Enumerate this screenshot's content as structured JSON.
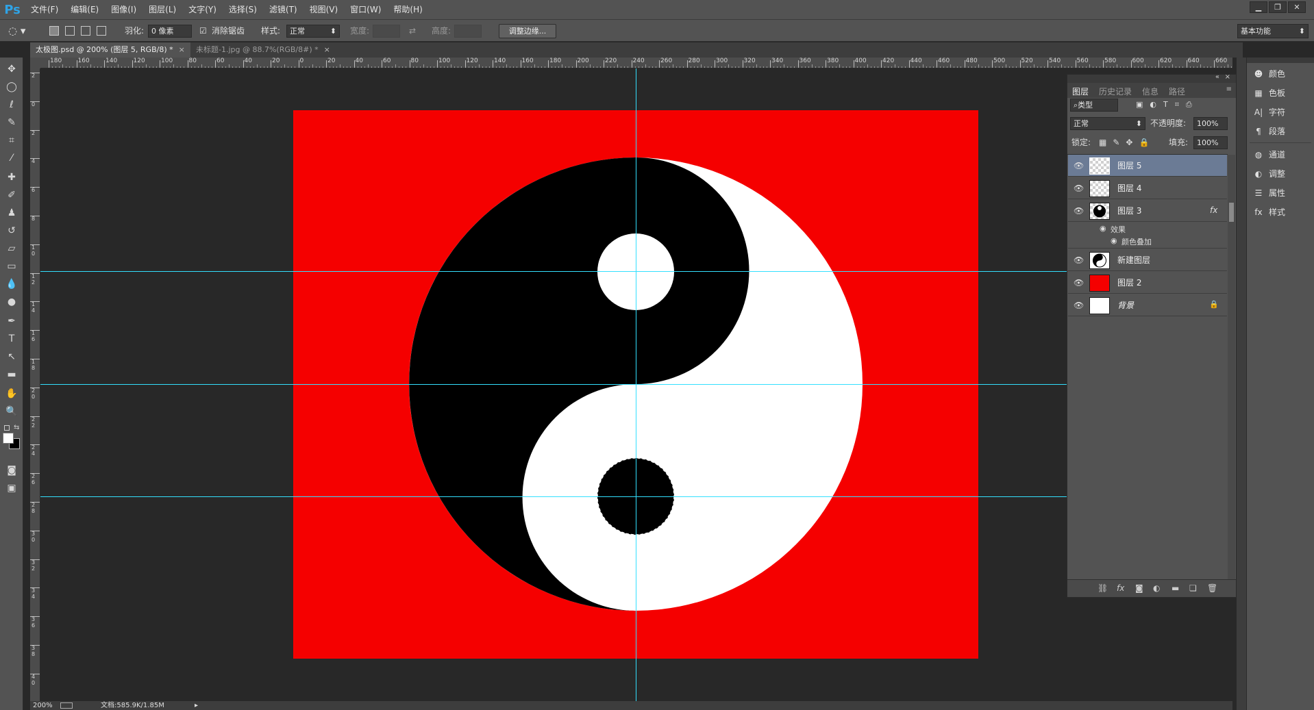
{
  "app": {
    "logo": "Ps"
  },
  "menu": [
    "文件(F)",
    "编辑(E)",
    "图像(I)",
    "图层(L)",
    "文字(Y)",
    "选择(S)",
    "滤镜(T)",
    "视图(V)",
    "窗口(W)",
    "帮助(H)"
  ],
  "options": {
    "feather_label": "羽化:",
    "feather_value": "0 像素",
    "antialias_label": "消除锯齿",
    "style_label": "样式:",
    "style_value": "正常",
    "width_label": "宽度:",
    "height_label": "高度:",
    "refine_edge": "调整边缘...",
    "workspace": "基本功能"
  },
  "tabs": [
    {
      "label": "太极图.psd @ 200% (图层 5, RGB/8) *"
    },
    {
      "label": "未标题-1.jpg @ 88.7%(RGB/8#) *"
    }
  ],
  "ruler": {
    "h_ticks": [
      "180",
      "160",
      "140",
      "120",
      "100",
      "80",
      "60",
      "40",
      "20",
      "0",
      "20",
      "40",
      "60",
      "80",
      "100",
      "120",
      "140",
      "160",
      "180",
      "200",
      "220",
      "240",
      "260",
      "280",
      "300",
      "320",
      "340",
      "360",
      "380",
      "400",
      "420",
      "440",
      "460",
      "480",
      "500",
      "520",
      "540",
      "560",
      "580",
      "600",
      "620",
      "640",
      "660"
    ],
    "v_ticks": [
      "2",
      "0",
      "2",
      "4",
      "6",
      "8",
      "1 0",
      "1 2",
      "1 4",
      "1 6",
      "1 8",
      "2 0",
      "2 2",
      "2 4",
      "2 6",
      "2 8",
      "3 0",
      "3 2",
      "3 4",
      "3 6",
      "3 8",
      "4 0"
    ]
  },
  "status": {
    "zoom": "200%",
    "doc": "文档:585.9K/1.85M"
  },
  "layers_panel": {
    "tabs": [
      "图层",
      "历史记录",
      "信息",
      "路径"
    ],
    "filter": "类型",
    "blend_mode": "正常",
    "opacity_label": "不透明度:",
    "opacity": "100%",
    "lock_label": "锁定:",
    "fill_label": "填充:",
    "fill": "100%",
    "layers": [
      {
        "name": "图层 5",
        "selected": true
      },
      {
        "name": "图层 4"
      },
      {
        "name": "图层 3",
        "fx": "fx",
        "effects_label": "效果",
        "effect": "颜色叠加"
      },
      {
        "name": "新建图层"
      },
      {
        "name": "图层 2"
      },
      {
        "name": "背景"
      }
    ]
  },
  "dock": [
    "颜色",
    "色板",
    "字符",
    "段落",
    "通道",
    "调整",
    "属性",
    "样式"
  ],
  "colors": {
    "doc_bg": "#f50000",
    "guide": "#33e0ff",
    "selected_layer": "#6b7b95"
  }
}
